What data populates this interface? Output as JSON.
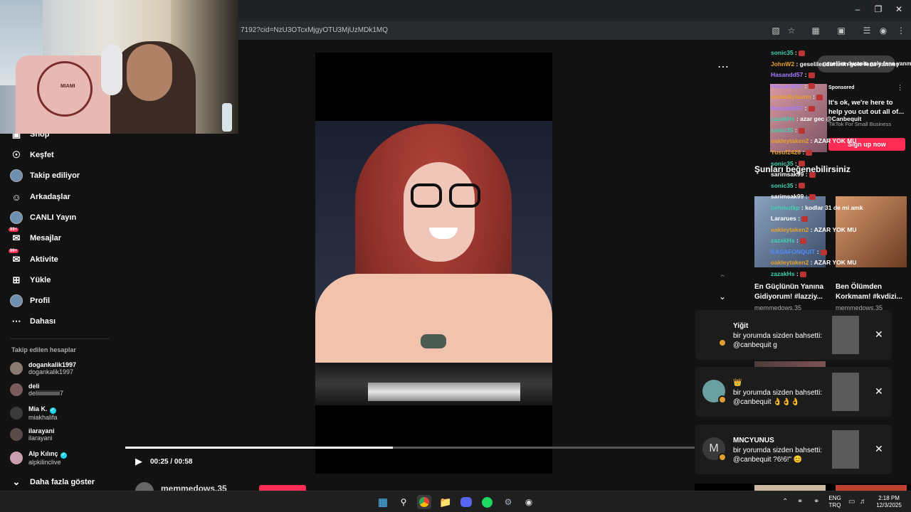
{
  "browser": {
    "url": "7192?cid=NzU3OTcxMjgyOTU3MjUzMDk1MQ"
  },
  "webcam": {
    "badge_text": "MIAMI"
  },
  "sidebar": {
    "items": [
      {
        "label": "Shop",
        "icon": "shop-icon"
      },
      {
        "label": "Keşfet",
        "icon": "compass-icon"
      },
      {
        "label": "Takip ediliyor",
        "icon": "avatar"
      },
      {
        "label": "Arkadaşlar",
        "icon": "friends-icon"
      },
      {
        "label": "CANLI Yayın",
        "icon": "avatar"
      },
      {
        "label": "Mesajlar",
        "icon": "messages-icon",
        "badge": "99+"
      },
      {
        "label": "Aktivite",
        "icon": "activity-icon",
        "badge": "99+"
      },
      {
        "label": "Yükle",
        "icon": "upload-icon"
      },
      {
        "label": "Profil",
        "icon": "avatar"
      },
      {
        "label": "Dahası",
        "icon": "more-icon"
      }
    ],
    "following_title": "Takip edilen hesaplar",
    "accounts": [
      {
        "name": "dogankalik1997",
        "handle": "dogankalik1997",
        "verified": false
      },
      {
        "name": "deli",
        "handle": "deliiiiiiiiiiiiiiii7",
        "verified": false
      },
      {
        "name": "Mia K.",
        "handle": "miakhalifa",
        "verified": true
      },
      {
        "name": "ilarayani",
        "handle": "ilarayani",
        "verified": false
      },
      {
        "name": "Alp Kılınç",
        "handle": "alpkilinclive",
        "verified": true
      }
    ],
    "show_more": "Daha fazla göster"
  },
  "video": {
    "current_time": "00:25",
    "duration": "00:58",
    "time_separator": " / ",
    "progress_fraction": 0.47,
    "author": "memmedows.35"
  },
  "chat": {
    "top_pill": "gesellier duranin gole fena yanmış",
    "lines": [
      {
        "user": "sonic35",
        "msg": ":",
        "color": "#3fd1b1"
      },
      {
        "user": "JohnW2",
        "msg": ": geseliler duranin gole fena yanmış",
        "color": "#e9a12a"
      },
      {
        "user": "Hasandd57",
        "msg": ":",
        "color": "#a37cff"
      },
      {
        "user": "Hasandd57",
        "msg": ":",
        "color": "#a37cff"
      },
      {
        "user": "anilaldiylaunn",
        "msg": ":",
        "color": "#e9a12a"
      },
      {
        "user": "Hasandd57",
        "msg": ":",
        "color": "#a37cff"
      },
      {
        "user": "zazakHs",
        "msg": ": azar gec @Canbequit",
        "color": "#3fd1b1"
      },
      {
        "user": "sonic35",
        "msg": ":",
        "color": "#3fd1b1"
      },
      {
        "user": "oakleytaken2",
        "msg": ": AZAR YOK MU",
        "color": "#e9a12a"
      },
      {
        "user": "Yusuf2428",
        "msg": ":",
        "color": "#e9a12a"
      },
      {
        "user": "sonic35",
        "msg": ":",
        "color": "#3fd1b1"
      },
      {
        "user": "sarimsak99",
        "msg": ":",
        "color": "#ffffff"
      },
      {
        "user": "sonic35",
        "msg": ":",
        "color": "#3fd1b1"
      },
      {
        "user": "sarimsak99",
        "msg": ":",
        "color": "#ffffff"
      },
      {
        "user": "behmutkp",
        "msg": ": kodlar 31 de mi amk",
        "color": "#3fd1b1"
      },
      {
        "user": "Lararues",
        "msg": ":",
        "color": "#ffffff"
      },
      {
        "user": "oakleytaken2",
        "msg": ": AZAR YOK MU",
        "color": "#e9a12a"
      },
      {
        "user": "zazakHs",
        "msg": ":",
        "color": "#3fd1b1"
      },
      {
        "user": "KASAFONQUIT",
        "msg": ":",
        "color": "#4d8dff"
      },
      {
        "user": "oakleytaken2",
        "msg": ": AZAR YOK MU",
        "color": "#e9a12a"
      },
      {
        "user": "zazakHs",
        "msg": ":",
        "color": "#3fd1b1"
      }
    ]
  },
  "ad": {
    "sponsored": "Sponsored",
    "headline": "It's ok, we're here to help you cut out all of...",
    "advertiser": "TikTok For Small Business",
    "cta": "Sign up now"
  },
  "recommendations": {
    "title": "Şunları beğenebilirsiniz",
    "items": [
      {
        "caption": "En Güçlünün Yanına Gidiyorum! #lazziy...",
        "author": "memmedows.35"
      },
      {
        "caption": "Ben Ölümden Korkmam! #kvdizi...",
        "author": "memmedows.35"
      }
    ],
    "partial_text": "nce"
  },
  "notifications": [
    {
      "name": "Yiğit",
      "line1": "bir yorumda sizden bahsetti:",
      "line2": "@canbequit g",
      "avatar_letter": ""
    },
    {
      "name": "👑",
      "line1": "bir yorumda sizden bahsetti:",
      "line2": "@canbequit 👌👌👌",
      "avatar_letter": ""
    },
    {
      "name": "MNCYUNUS",
      "line1": "bir yorumda sizden bahsetti:",
      "line2": "@canbequit ?6!6!\" 😊",
      "avatar_letter": "M"
    }
  ],
  "taskbar": {
    "lang_top": "ENG",
    "lang_bottom": "TRQ",
    "time": "2:18 PM",
    "date": "12/3/2025"
  }
}
